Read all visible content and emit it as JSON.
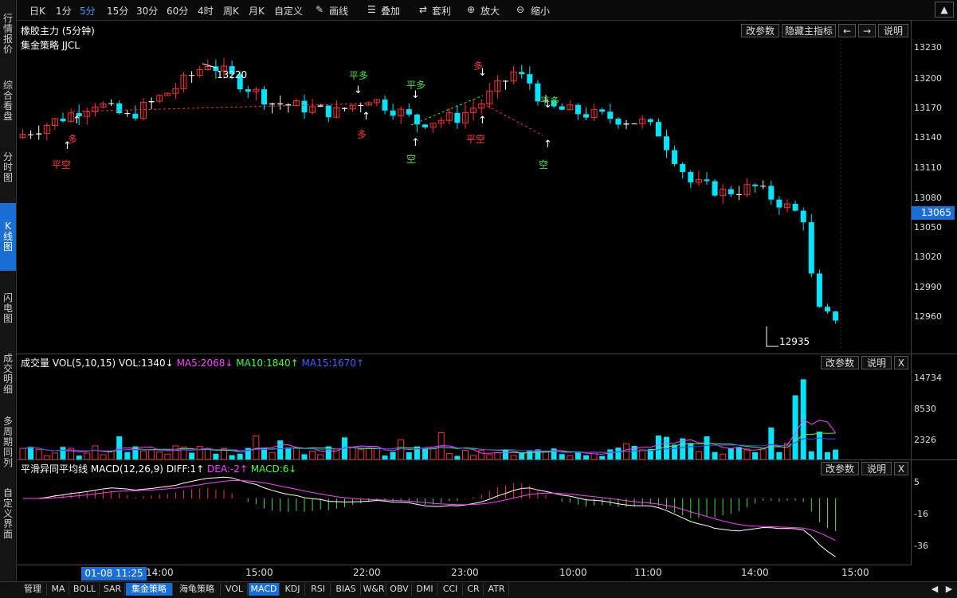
{
  "sidebar": {
    "items": [
      {
        "label": "行情报价",
        "active": false
      },
      {
        "label": "综合看盘",
        "active": false
      },
      {
        "label": "分时图",
        "active": false
      },
      {
        "label": "K线图",
        "active": true
      },
      {
        "label": "闪电图",
        "active": false
      },
      {
        "label": "成交明细",
        "active": false
      },
      {
        "label": "多周期同列",
        "active": false
      },
      {
        "label": "自定义界面",
        "active": false
      }
    ]
  },
  "toolbar": {
    "periods": [
      "日K",
      "1分",
      "5分",
      "15分",
      "30分",
      "60分",
      "4时",
      "周K",
      "月K",
      "自定义"
    ],
    "selected_period": "5分",
    "draw_line": "画线",
    "overlay": "叠加",
    "arbitrage": "套利",
    "zoom_in": "放大",
    "zoom_out": "缩小"
  },
  "main": {
    "title": "橡胶主力 (5分钟)",
    "strategy": "集金策略 JJCL",
    "btn_params": "改参数",
    "btn_hide": "隐藏主指标",
    "btn_left": "←",
    "btn_right": "→",
    "btn_help": "说明",
    "high_label": "13220",
    "low_label": "12935",
    "current_price": "13065",
    "y_ticks": [
      "13230",
      "13200",
      "13170",
      "13140",
      "13110",
      "13080",
      "13050",
      "13020",
      "12990",
      "12960"
    ]
  },
  "volume": {
    "title": "成交量",
    "params": "VOL(5,10,15)",
    "vol": "VOL:1340↓",
    "ma5": "MA5:2068↓",
    "ma10": "MA10:1840↑",
    "ma15": "MA15:1670↑",
    "btn_params": "改参数",
    "btn_help": "说明",
    "btn_close": "X",
    "y_ticks": [
      "14734",
      "8530",
      "2326"
    ]
  },
  "macd": {
    "title": "平滑异同平均线",
    "params": "MACD(12,26,9)",
    "diff": "DIFF:1↑",
    "dea": "DEA:-2↑",
    "macd_val": "MACD:6↓",
    "btn_params": "改参数",
    "btn_help": "说明",
    "btn_close": "X",
    "y_ticks": [
      "5",
      "-16",
      "-36"
    ]
  },
  "xaxis": {
    "cursor_time": "01-08 11:25",
    "labels": [
      "14:00",
      "15:00",
      "22:00",
      "23:00",
      "10:00",
      "11:00",
      "14:00",
      "15:00"
    ]
  },
  "signals": [
    {
      "text": "平空",
      "color": "#ff3030"
    },
    {
      "text": "多",
      "color": "#ff3030"
    },
    {
      "text": "平多",
      "color": "#40e040"
    },
    {
      "text": "多",
      "color": "#ff3030"
    },
    {
      "text": "平多",
      "color": "#40e040"
    },
    {
      "text": "空",
      "color": "#40e040"
    },
    {
      "text": "多",
      "color": "#ff3030"
    },
    {
      "text": "平空",
      "color": "#ff3030"
    },
    {
      "text": "平多",
      "color": "#40e040"
    },
    {
      "text": "空",
      "color": "#40e040"
    }
  ],
  "bottom_tabs": [
    "管理",
    "MA",
    "BOLL",
    "SAR",
    "集金策略",
    "海龟策略",
    "VOL",
    "MACD",
    "KDJ",
    "RSI",
    "BIAS",
    "W&R",
    "OBV",
    "DMI",
    "CCI",
    "CR",
    "ATR"
  ],
  "bottom_tabs_selected": [
    "集金策略",
    "MACD"
  ],
  "colors": {
    "up": "#ff3030",
    "down": "#00e5ff",
    "flat": "#ffffff",
    "ma5": "#ff40ff",
    "ma10": "#40ff40",
    "ma15": "#4040ff",
    "accent": "#1a6fd6"
  },
  "chart_data": {
    "type": "candlestick",
    "y_range": [
      12920,
      13240
    ],
    "candles_ohlc": [
      [
        13136,
        13145,
        13128,
        13138
      ],
      [
        13138,
        13160,
        13135,
        13155
      ],
      [
        13155,
        13158,
        13130,
        13140
      ],
      [
        13140,
        13165,
        13136,
        13160
      ],
      [
        13160,
        13168,
        13140,
        13145
      ],
      [
        13145,
        13180,
        13140,
        13175
      ],
      [
        13175,
        13182,
        13150,
        13160
      ],
      [
        13160,
        13170,
        13140,
        13148
      ],
      [
        13148,
        13190,
        13145,
        13185
      ],
      [
        13185,
        13190,
        13155,
        13162
      ],
      [
        13162,
        13170,
        13145,
        13155
      ],
      [
        13155,
        13168,
        13150,
        13160
      ],
      [
        13160,
        13165,
        13150,
        13158
      ],
      [
        13158,
        13170,
        13152,
        13160
      ],
      [
        13160,
        13175,
        13150,
        13155
      ],
      [
        13155,
        13170,
        13130,
        13162
      ],
      [
        13162,
        13192,
        13158,
        13188
      ],
      [
        13188,
        13200,
        13175,
        13180
      ],
      [
        13180,
        13205,
        13176,
        13198
      ],
      [
        13198,
        13212,
        13190,
        13208
      ],
      [
        13208,
        13222,
        13200,
        13215
      ]
    ]
  }
}
